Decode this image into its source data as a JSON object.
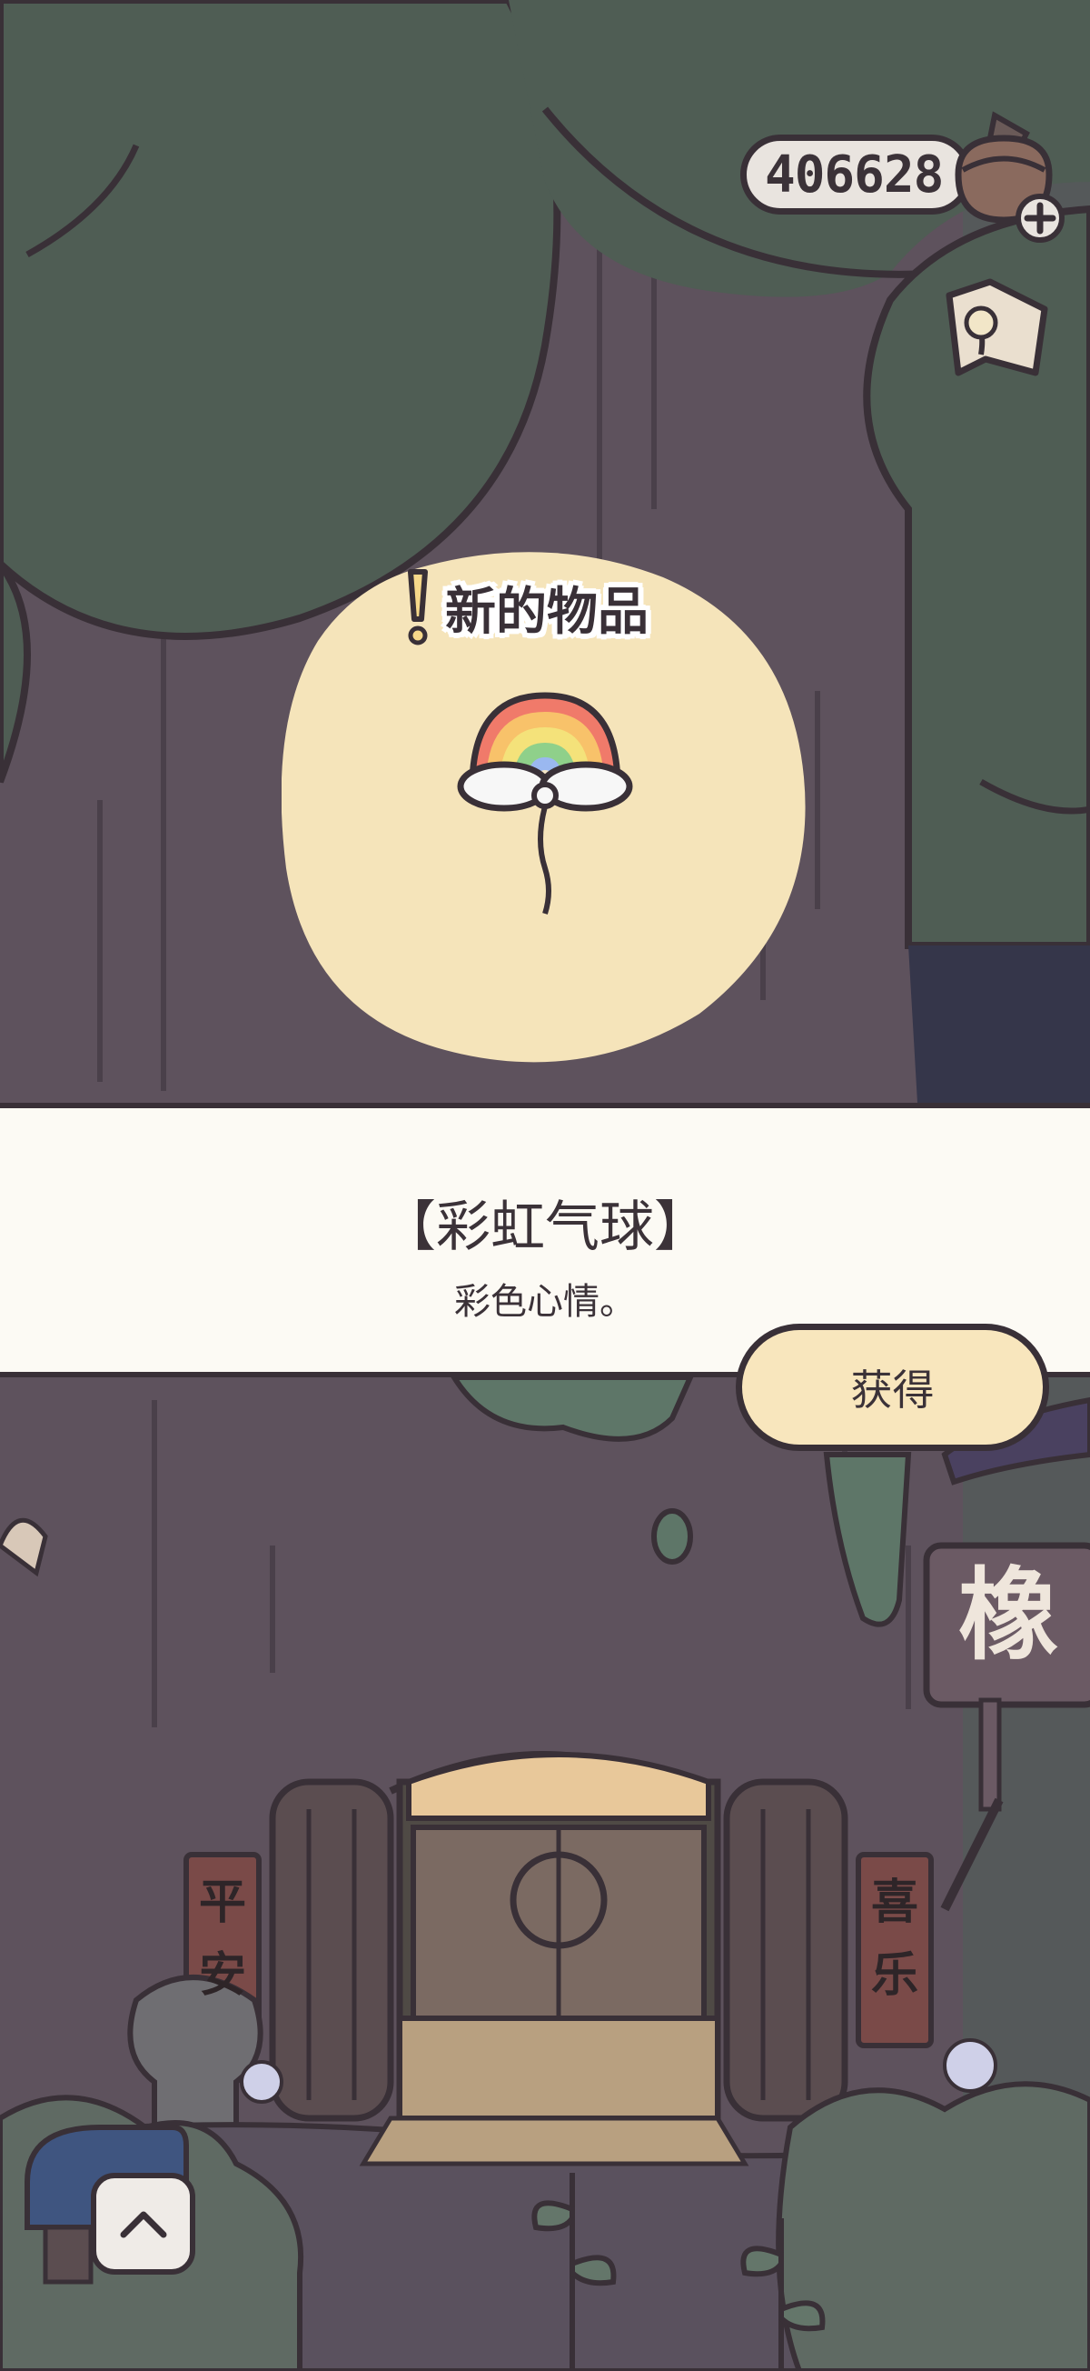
{
  "hud": {
    "acorn_count": "406628",
    "acorn_icon": "acorn-add-icon",
    "map_icon": "map-icon"
  },
  "reward": {
    "tag": "新的物品",
    "item_name": "【彩虹气球】",
    "item_description": "彩色心情。",
    "obtain_label": "获得",
    "item_icon": "rainbow-balloon-icon"
  },
  "scene": {
    "left_couplet": "平安",
    "right_couplet": "喜乐",
    "shop_sign": "橡",
    "expand_icon": "chevron-up-icon"
  },
  "colors": {
    "outline": "#393037",
    "tree": "#4f5d54",
    "bark": "#5a4f5a",
    "glow": "#f5e4ba",
    "panel": "#fcfaf4",
    "button": "#f8e6bd"
  }
}
